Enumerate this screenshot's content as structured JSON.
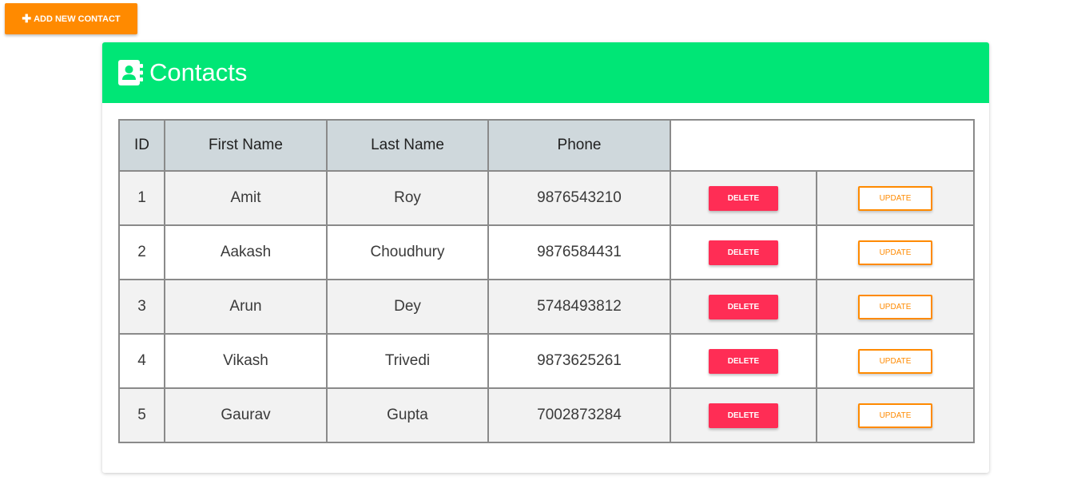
{
  "toolbar": {
    "add_contact_label": "ADD NEW CONTACT",
    "add_icon": "plus-icon"
  },
  "card": {
    "title": "Contacts",
    "icon": "address-book-icon",
    "header_color": "#00e676"
  },
  "table": {
    "columns": [
      "ID",
      "First Name",
      "Last Name",
      "Phone",
      ""
    ],
    "rows": [
      {
        "id": "1",
        "first_name": "Amit",
        "last_name": "Roy",
        "phone": "9876543210",
        "delete_label": "DELETE",
        "update_label": "UPDATE"
      },
      {
        "id": "2",
        "first_name": "Aakash",
        "last_name": "Choudhury",
        "phone": "9876584431",
        "delete_label": "DELETE",
        "update_label": "UPDATE"
      },
      {
        "id": "3",
        "first_name": "Arun",
        "last_name": "Dey",
        "phone": "5748493812",
        "delete_label": "DELETE",
        "update_label": "UPDATE"
      },
      {
        "id": "4",
        "first_name": "Vikash",
        "last_name": "Trivedi",
        "phone": "9873625261",
        "delete_label": "DELETE",
        "update_label": "UPDATE"
      },
      {
        "id": "5",
        "first_name": "Gaurav",
        "last_name": "Gupta",
        "phone": "7002873284",
        "delete_label": "DELETE",
        "update_label": "UPDATE"
      }
    ]
  },
  "colors": {
    "accent_orange": "#ff8a00",
    "delete_red": "#ff2d55",
    "header_green": "#00e676",
    "table_header_bg": "#cfd8dc"
  }
}
